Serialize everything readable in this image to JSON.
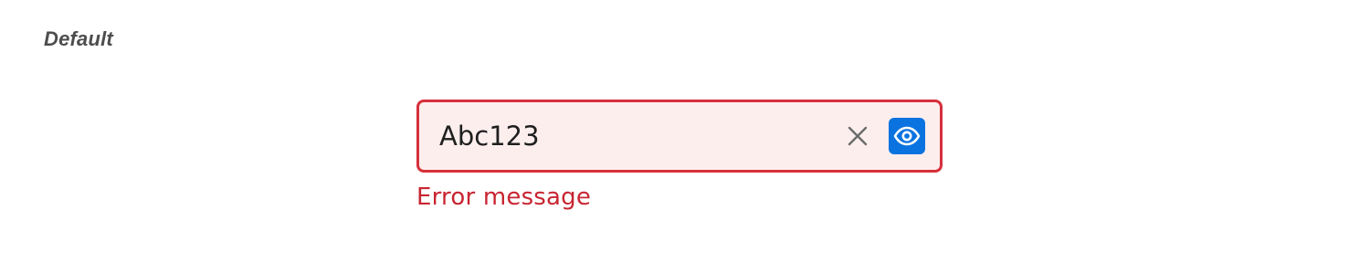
{
  "section": {
    "label": "Default"
  },
  "field": {
    "value": "Abc123",
    "error_message": "Error message",
    "clear_icon": "close-icon",
    "reveal_icon": "eye-icon"
  },
  "colors": {
    "error_border": "#d7303c",
    "error_background": "#fdeeee",
    "error_text": "#c82532",
    "accent": "#0a73e0"
  }
}
